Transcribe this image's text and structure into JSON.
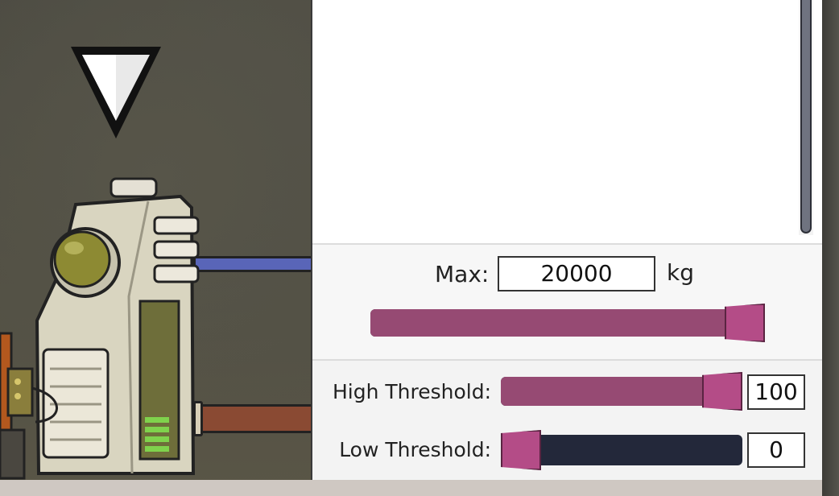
{
  "capacity": {
    "max_label": "Max:",
    "max_value": "20000",
    "unit": "kg",
    "slider_fraction": 1.0
  },
  "thresholds": {
    "high_label": "High Threshold:",
    "high_value": "100",
    "high_fraction": 1.0,
    "low_label": "Low Threshold:",
    "low_value": "0",
    "low_fraction": 0.0
  },
  "colors": {
    "slider_fill": "#964a73",
    "slider_handle": "#b44c87",
    "slider_empty": "#23283a",
    "pipe_blue": "#5965b8",
    "pipe_copper": "#8a4a33"
  },
  "icons": {
    "pointer": "selection-triangle-icon",
    "machine": "smart-storage-bin-icon"
  }
}
